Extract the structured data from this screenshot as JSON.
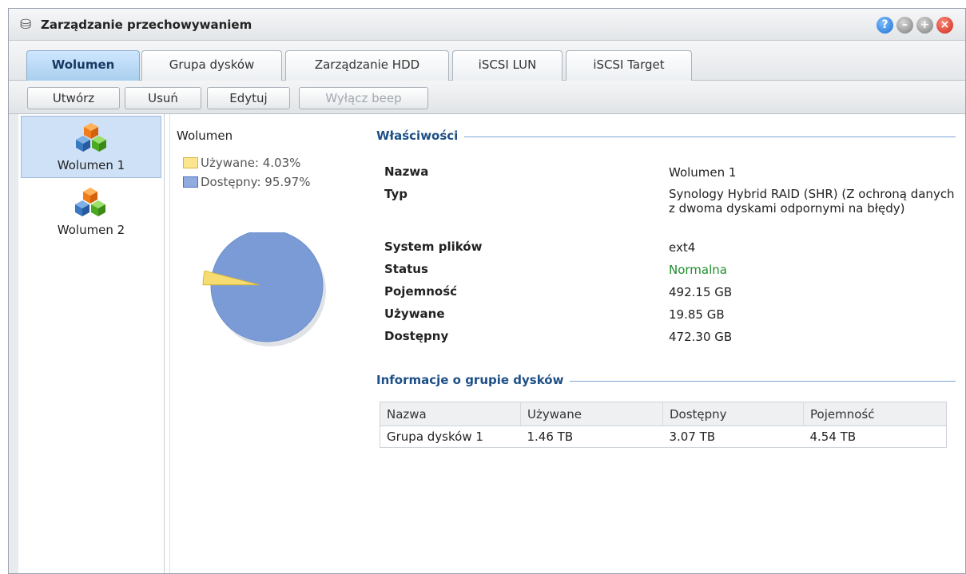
{
  "window": {
    "title": "Zarządzanie przechowywaniem"
  },
  "tabs": [
    {
      "label": "Wolumen"
    },
    {
      "label": "Grupa dysków"
    },
    {
      "label": "Zarządzanie HDD"
    },
    {
      "label": "iSCSI LUN"
    },
    {
      "label": "iSCSI Target"
    }
  ],
  "toolbar": {
    "create": "Utwórz",
    "delete": "Usuń",
    "edit": "Edytuj",
    "beep_off": "Wyłącz beep"
  },
  "volumes": [
    {
      "label": "Wolumen 1"
    },
    {
      "label": "Wolumen 2"
    }
  ],
  "usage": {
    "title": "Wolumen",
    "used_label": "Używane: 4.03%",
    "free_label": "Dostępny: 95.97%",
    "used_percent": 4.03,
    "free_percent": 95.97,
    "used_color": "#f7dc72",
    "free_color": "#7b9bd6"
  },
  "properties": {
    "heading": "Właściwości",
    "name_key": "Nazwa",
    "name_val": "Wolumen 1",
    "type_key": "Typ",
    "type_val": "Synology Hybrid RAID (SHR) (Z ochroną danych z dwoma dyskami odpornymi na błędy)",
    "fs_key": "System plików",
    "fs_val": "ext4",
    "status_key": "Status",
    "status_val": "Normalna",
    "capacity_key": "Pojemność",
    "capacity_val": "492.15 GB",
    "used_key": "Używane",
    "used_val": "19.85 GB",
    "free_key": "Dostępny",
    "free_val": "472.30 GB"
  },
  "disk_group": {
    "heading": "Informacje o grupie dysków",
    "columns": [
      "Nazwa",
      "Używane",
      "Dostępny",
      "Pojemność"
    ],
    "rows": [
      [
        "Grupa dysków 1",
        "1.46 TB",
        "3.07 TB",
        "4.54 TB"
      ]
    ]
  },
  "colors": {
    "accent": "#1d4f86",
    "status_ok": "#1e8e2d"
  }
}
